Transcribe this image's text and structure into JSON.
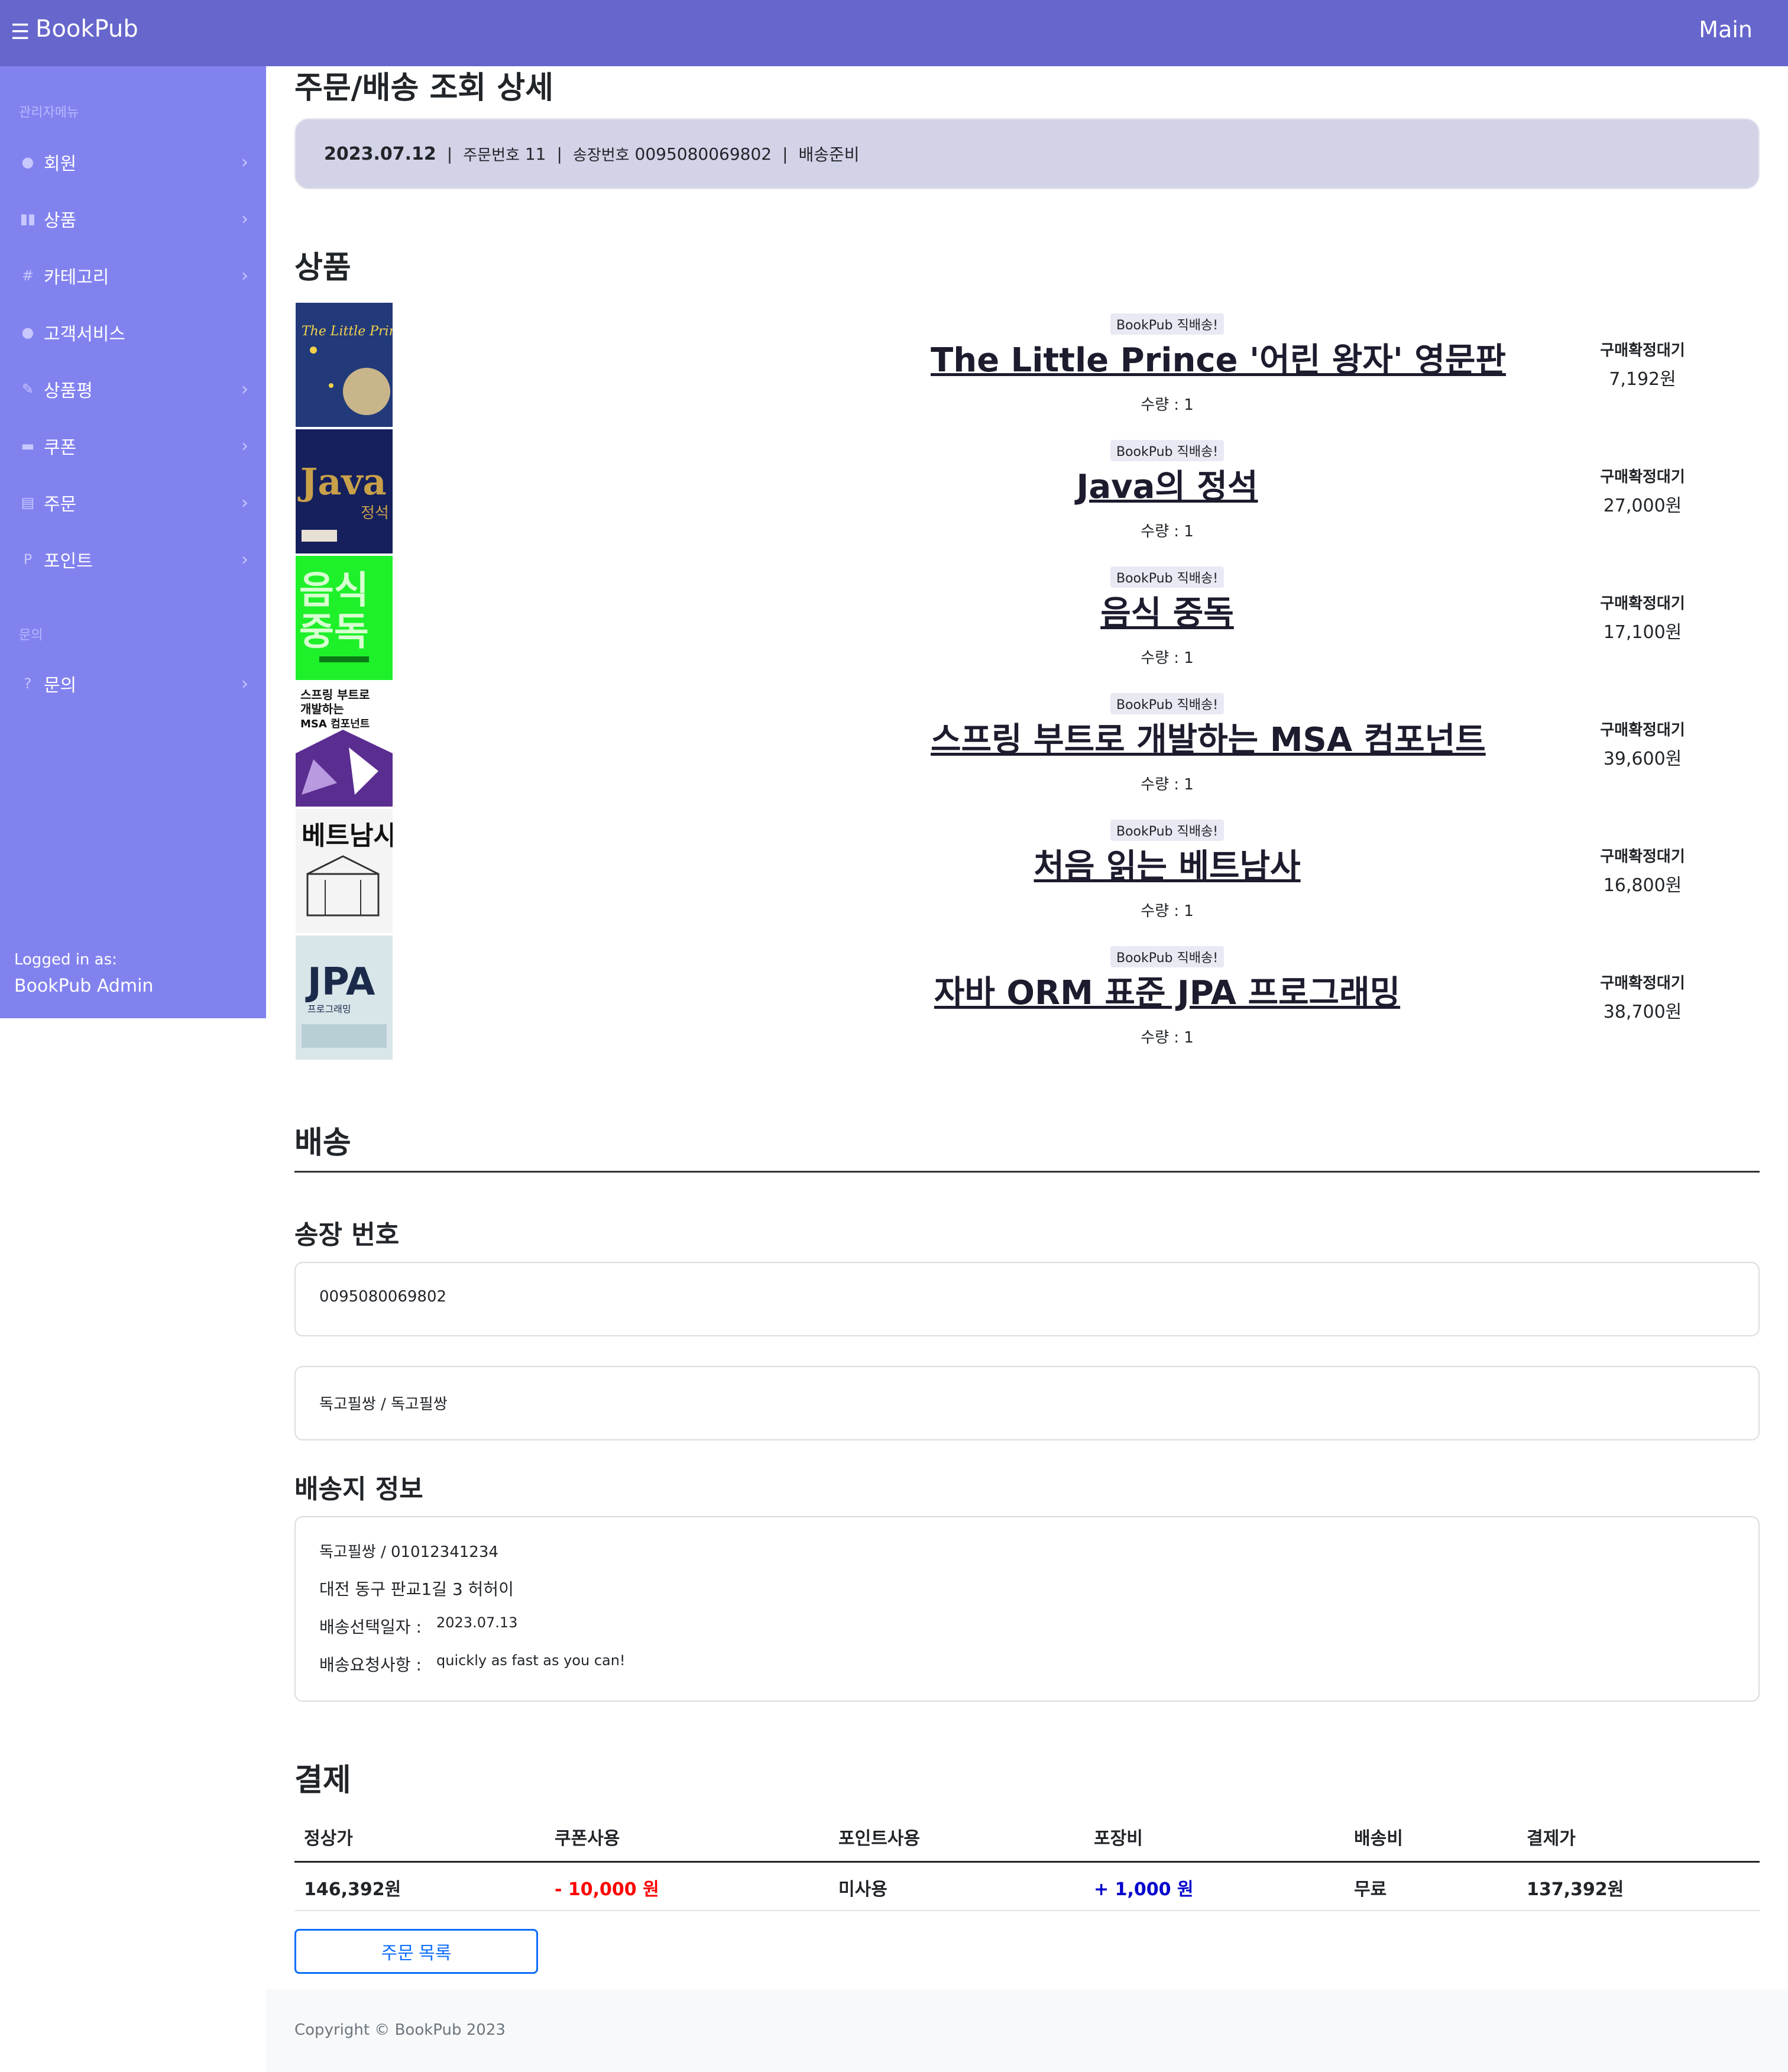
{
  "topbar": {
    "brand": "BookPub",
    "menu_icon": "☰",
    "main_link": "Main"
  },
  "sidebar": {
    "admin_heading": "관리자메뉴",
    "items": [
      {
        "label": "회원",
        "icon": "user-circle-icon",
        "glyph": "●"
      },
      {
        "label": "상품",
        "icon": "book-icon",
        "glyph": "▮▮"
      },
      {
        "label": "카테고리",
        "icon": "hash-icon",
        "glyph": "#"
      },
      {
        "label": "고객서비스",
        "icon": "info-icon",
        "glyph": "●"
      },
      {
        "label": "상품평",
        "icon": "review-icon",
        "glyph": "✎"
      },
      {
        "label": "쿠폰",
        "icon": "card-icon",
        "glyph": "▬"
      },
      {
        "label": "주문",
        "icon": "clipboard-icon",
        "glyph": "▤"
      },
      {
        "label": "포인트",
        "icon": "point-icon",
        "glyph": "P"
      }
    ],
    "inquiry_heading": "문의",
    "inquiry_item": {
      "label": "문의",
      "icon": "question-icon",
      "glyph": "?"
    },
    "logged_in_label": "Logged in as:",
    "logged_in_user": "BookPub Admin"
  },
  "page": {
    "title": "주문/배송 조회 상세",
    "summary": {
      "date": "2023.07.12",
      "order_no_label": "주문번호",
      "order_no": "11",
      "invoice_label": "송장번호",
      "invoice_no": "0095080069802",
      "status": "배송준비"
    }
  },
  "products": {
    "section_title": "상품",
    "items": [
      {
        "badge": "BookPub 직배송!",
        "title": "The Little Prince '어린 왕자' 영문판",
        "qty": "수량 : 1",
        "status": "구매확정대기",
        "price": "7,192원",
        "cover_color": "#223a7a",
        "cover_text": "The Little Prince"
      },
      {
        "badge": "BookPub 직배송!",
        "title": "Java의 정석",
        "qty": "수량 : 1",
        "status": "구매확정대기",
        "price": "27,000원",
        "cover_color": "#15205c",
        "cover_text": "Java의 정석"
      },
      {
        "badge": "BookPub 직배송!",
        "title": "음식 중독",
        "qty": "수량 : 1",
        "status": "구매확정대기",
        "price": "17,100원",
        "cover_color": "#1ef02a",
        "cover_text": "음식 중독"
      },
      {
        "badge": "BookPub 직배송!",
        "title": "스프링 부트로 개발하는 MSA 컴포넌트",
        "qty": "수량 : 1",
        "status": "구매확정대기",
        "price": "39,600원",
        "cover_color": "#5a2d91",
        "cover_text": "스프링 부트로 개발하는 MSA 컴포넌트"
      },
      {
        "badge": "BookPub 직배송!",
        "title": "처음 읽는 베트남사",
        "qty": "수량 : 1",
        "status": "구매확정대기",
        "price": "16,800원",
        "cover_color": "#f4f4f4",
        "cover_text": "베트남사"
      },
      {
        "badge": "BookPub 직배송!",
        "title": "자바 ORM 표준 JPA 프로그래밍",
        "qty": "수량 : 1",
        "status": "구매확정대기",
        "price": "38,700원",
        "cover_color": "#d8e6ea",
        "cover_text": "JPA"
      }
    ]
  },
  "shipping": {
    "section_title": "배송",
    "invoice_title": "송장 번호",
    "invoice_value": "0095080069802",
    "recipient_value": "독고필쌍 / 독고필쌍",
    "address_title": "배송지 정보",
    "address_name_phone": "독고필쌍 / 01012341234",
    "address": "대전 동구 판교1길 3 허허이",
    "date_label": "배송선택일자 :",
    "date_value": "2023.07.13",
    "request_label": "배송요청사항 :",
    "request_value": "quickly as fast as you can!"
  },
  "payment": {
    "section_title": "결제",
    "headers": [
      "정상가",
      "쿠폰사용",
      "포인트사용",
      "포장비",
      "배송비",
      "결제가"
    ],
    "values": [
      "146,392원",
      "- 10,000 원",
      "미사용",
      "+ 1,000 원",
      "무료",
      "137,392원"
    ],
    "discount_color": "#ff0000",
    "packaging_color": "#0000cc"
  },
  "list_button": "주문 목록",
  "footer": "Copyright © BookPub 2023"
}
